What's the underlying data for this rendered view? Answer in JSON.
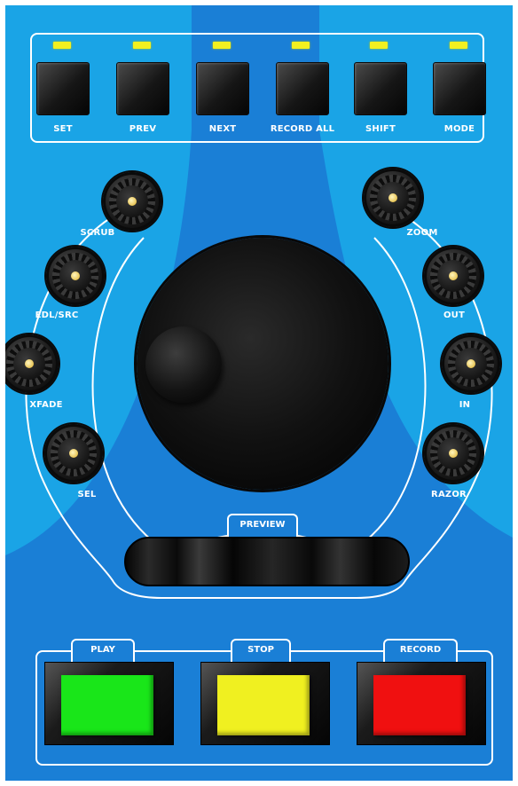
{
  "top_buttons": [
    {
      "label": "SET"
    },
    {
      "label": "PREV"
    },
    {
      "label": "NEXT"
    },
    {
      "label": "RECORD  ALL"
    },
    {
      "label": "SHIFT"
    },
    {
      "label": "MODE"
    }
  ],
  "left_knobs": [
    {
      "label": "SCRUB"
    },
    {
      "label": "EDL/SRC"
    },
    {
      "label": "XFADE"
    },
    {
      "label": "SEL"
    }
  ],
  "right_knobs": [
    {
      "label": "ZOOM"
    },
    {
      "label": "OUT"
    },
    {
      "label": "IN"
    },
    {
      "label": "RAZOR"
    }
  ],
  "preview": {
    "label": "PREVIEW"
  },
  "transport": [
    {
      "label": "PLAY",
      "color": "#19e619"
    },
    {
      "label": "STOP",
      "color": "#f0f020"
    },
    {
      "label": "RECORD",
      "color": "#f01010"
    }
  ],
  "colors": {
    "light_blue": "#1aa4e6",
    "dark_blue": "#1a7fd6",
    "led": "#f2f020",
    "outline": "#ffffff"
  }
}
